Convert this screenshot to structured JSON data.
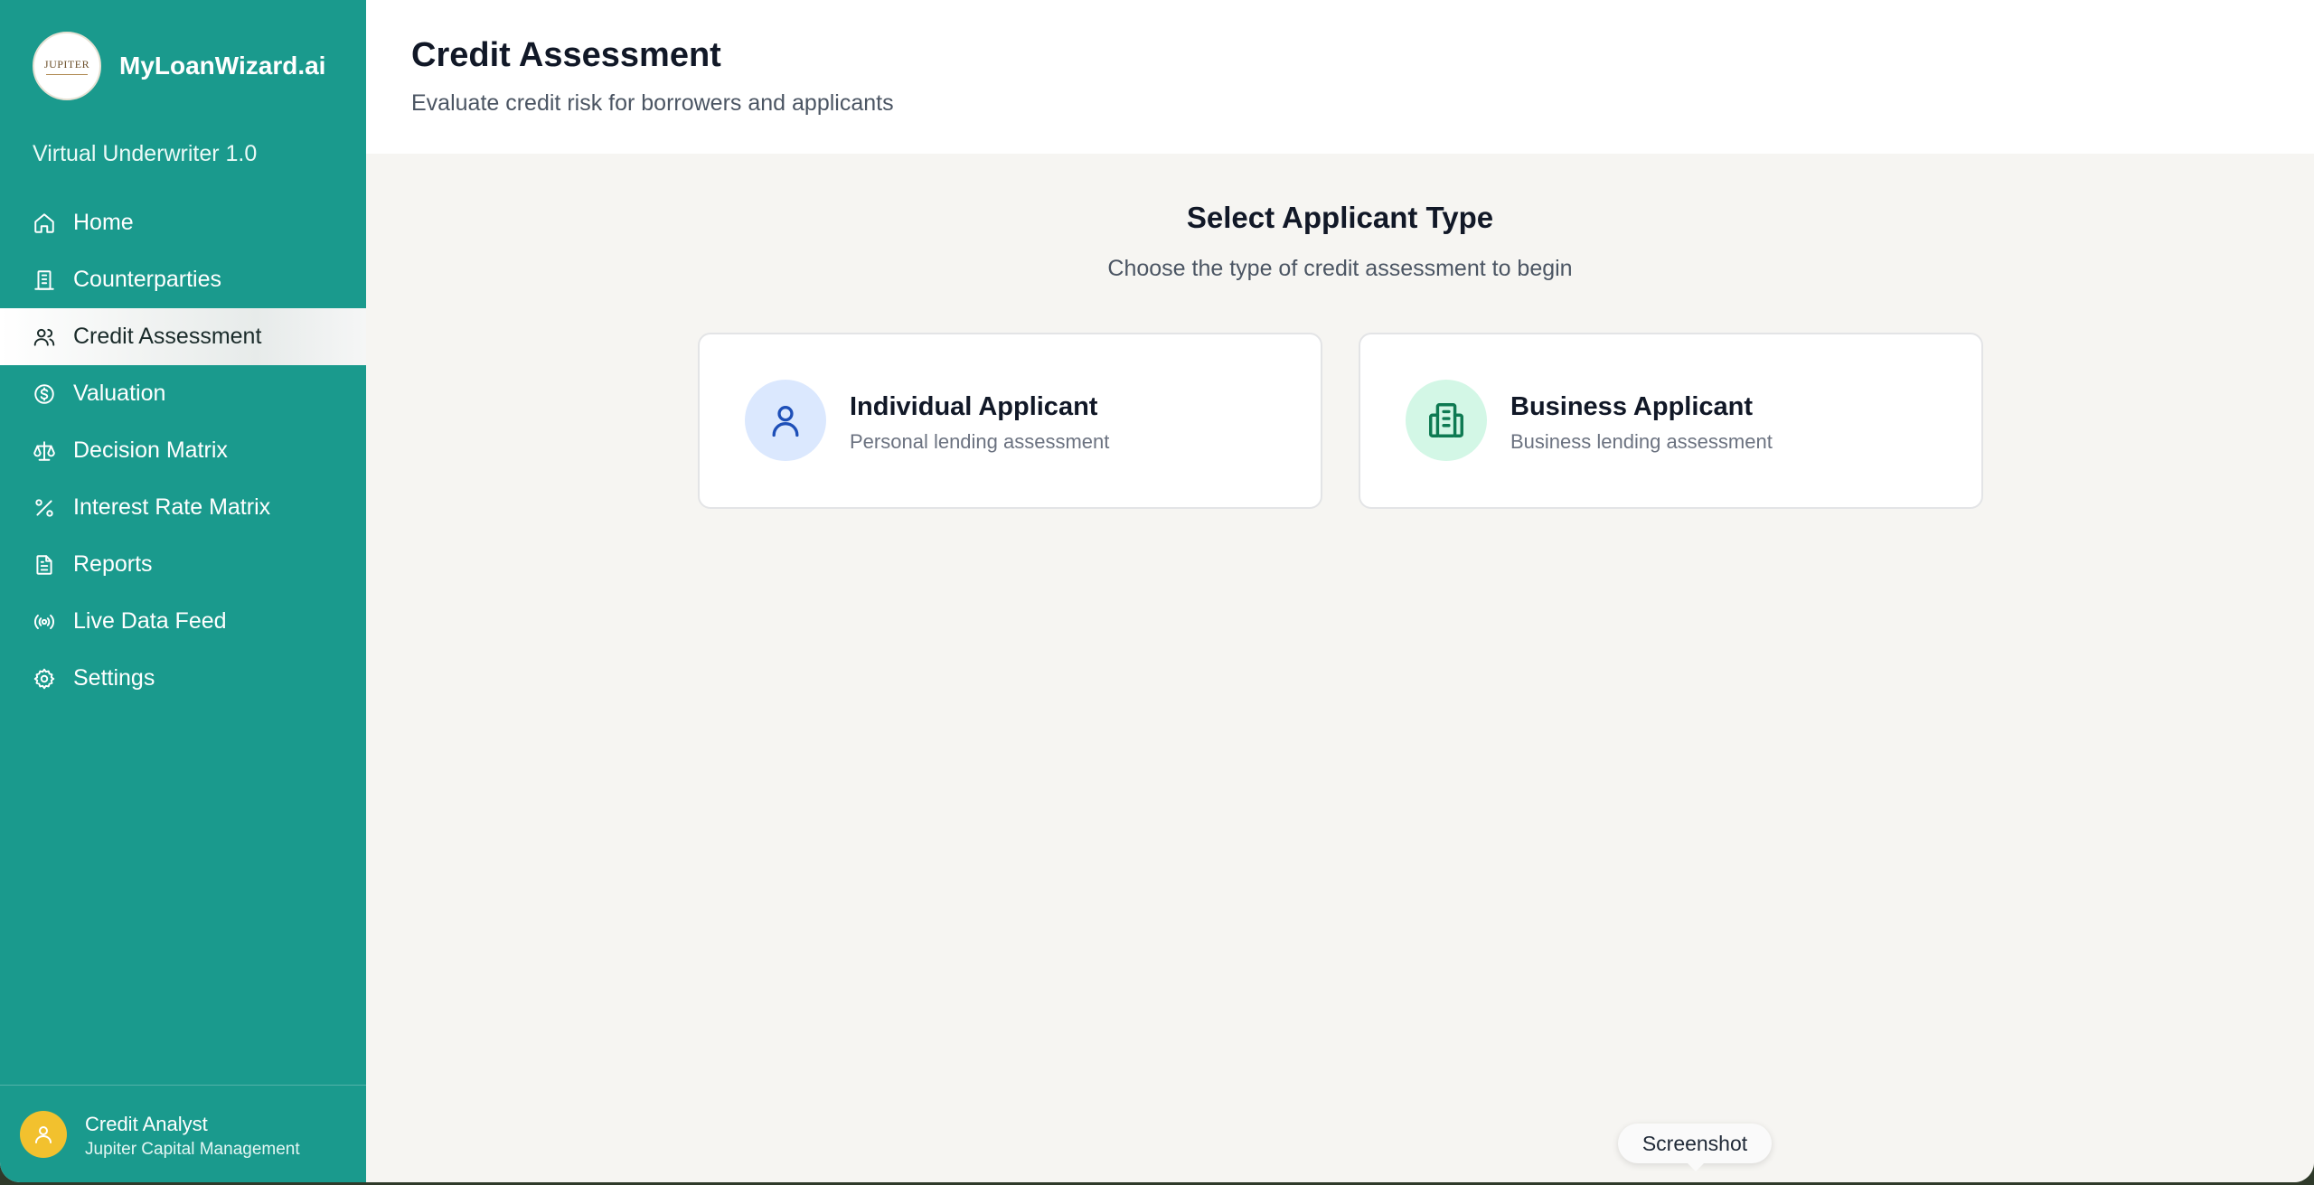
{
  "app": {
    "brand_name": "MyLoanWizard.ai",
    "logo_text": "JUPITER",
    "version": "Virtual Underwriter 1.0"
  },
  "sidebar": {
    "items": [
      {
        "label": "Home",
        "icon": "home-icon"
      },
      {
        "label": "Counterparties",
        "icon": "building-icon"
      },
      {
        "label": "Credit Assessment",
        "icon": "users-icon",
        "active": true
      },
      {
        "label": "Valuation",
        "icon": "dollar-circle-icon"
      },
      {
        "label": "Decision Matrix",
        "icon": "scale-icon"
      },
      {
        "label": "Interest Rate Matrix",
        "icon": "percent-icon"
      },
      {
        "label": "Reports",
        "icon": "document-icon"
      },
      {
        "label": "Live Data Feed",
        "icon": "broadcast-icon"
      },
      {
        "label": "Settings",
        "icon": "gear-icon"
      }
    ],
    "user": {
      "name": "Credit Analyst",
      "org": "Jupiter Capital Management"
    }
  },
  "header": {
    "title": "Credit Assessment",
    "subtitle": "Evaluate credit risk for borrowers and applicants"
  },
  "main": {
    "section_title": "Select Applicant Type",
    "section_subtitle": "Choose the type of credit assessment to begin",
    "cards": [
      {
        "title": "Individual Applicant",
        "description": "Personal lending assessment",
        "icon": "user-icon"
      },
      {
        "title": "Business Applicant",
        "description": "Business lending assessment",
        "icon": "building-icon"
      }
    ]
  },
  "tooltip": {
    "label": "Screenshot"
  },
  "colors": {
    "sidebar": "#1a9a8d",
    "individual_icon_bg": "#dbe8fe",
    "business_icon_bg": "#d3f7e6",
    "avatar": "#f2c12e"
  }
}
